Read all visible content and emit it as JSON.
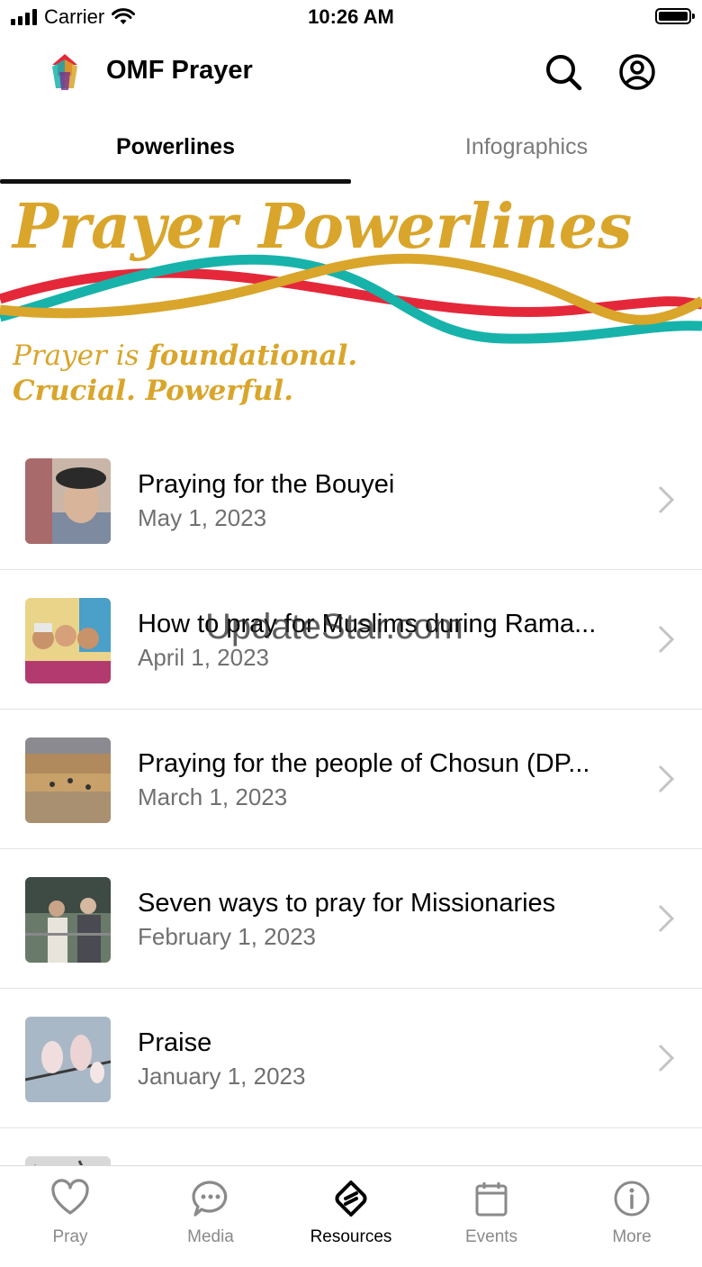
{
  "status_bar": {
    "carrier": "Carrier",
    "time": "10:26 AM"
  },
  "app_bar": {
    "title": "OMF Prayer",
    "icons": [
      "search-icon",
      "account-icon"
    ]
  },
  "tabs": [
    {
      "label": "Powerlines",
      "active": true
    },
    {
      "label": "Infographics",
      "active": false
    }
  ],
  "banner": {
    "title": "Prayer Powerlines",
    "subtitle_line1_prefix": "Prayer is ",
    "subtitle_line1_bold": "foundational.",
    "subtitle_line2": "Crucial. Powerful.",
    "colors": {
      "gold": "#d9a52b",
      "red": "#e4283a",
      "teal": "#17b3aa"
    }
  },
  "list": [
    {
      "title": "Praying for the Bouyei",
      "date": "May 1, 2023"
    },
    {
      "title": "How to pray for Muslims during Rama...",
      "date": "April 1, 2023"
    },
    {
      "title": "Praying for the people of Chosun (DP...",
      "date": "March 1, 2023"
    },
    {
      "title": "Seven ways to pray for Missionaries",
      "date": "February 1, 2023"
    },
    {
      "title": "Praise",
      "date": "January 1, 2023"
    }
  ],
  "watermark": "UpdateStar.com",
  "tab_bar": [
    {
      "label": "Pray",
      "icon": "heart-icon",
      "active": false
    },
    {
      "label": "Media",
      "icon": "chat-bubble-icon",
      "active": false
    },
    {
      "label": "Resources",
      "icon": "resources-link-icon",
      "active": true
    },
    {
      "label": "Events",
      "icon": "calendar-icon",
      "active": false
    },
    {
      "label": "More",
      "icon": "info-icon",
      "active": false
    }
  ]
}
